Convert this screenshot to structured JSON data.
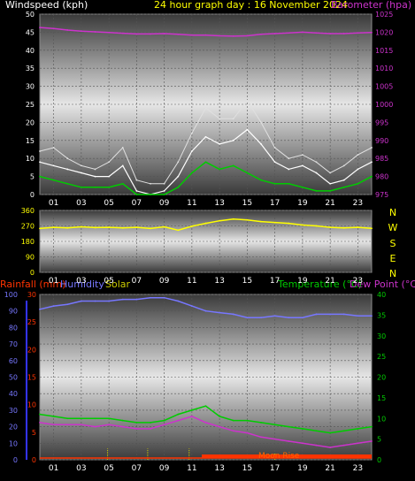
{
  "colors": {
    "windspeed": "#ffffff",
    "windgust": "#e0e0e0",
    "windavg": "#00cc00",
    "barometer": "#cc33cc",
    "direction": "#ffff00",
    "humidity": "#7777ff",
    "temperature": "#00cc00",
    "dewpoint": "#cc33cc",
    "rainfall": "#ff3300",
    "solar": "#cccc00",
    "moon": "#ff6600"
  },
  "header": {
    "windspeed_label": "Windspeed (kph)",
    "title": "24 hour graph day : 16 November 2024",
    "barometer_label": "Barometer (hpa)"
  },
  "bottom_header": {
    "rainfall_label": "Rainfall (mm)",
    "humidity_label": "Humidity",
    "solar_label": "Solar",
    "temperature_label": "Temperature (°C)",
    "dewpoint_label": "Dew Point (°C)"
  },
  "moon_label": "Moon Rise",
  "chart_data": [
    {
      "type": "line",
      "title": "24 hour graph day : 16 November 2024",
      "x_ticks": [
        "01",
        "03",
        "05",
        "07",
        "09",
        "11",
        "13",
        "15",
        "17",
        "19",
        "21",
        "23"
      ],
      "xlim": [
        0,
        24
      ],
      "ylabel_left": "Windspeed (kph)",
      "ylim_left": [
        0,
        50
      ],
      "y_ticks_left": [
        0,
        5,
        10,
        15,
        20,
        25,
        30,
        35,
        40,
        45,
        50
      ],
      "ylabel_right": "Barometer (hpa)",
      "ylim_right": [
        975,
        1025
      ],
      "y_ticks_right": [
        975,
        980,
        985,
        990,
        995,
        1000,
        1005,
        1010,
        1015,
        1020,
        1025
      ],
      "series": [
        {
          "name": "Barometer (hpa)",
          "axis": "right",
          "x": [
            0,
            1,
            2,
            3,
            4,
            5,
            6,
            7,
            8,
            9,
            10,
            11,
            12,
            13,
            14,
            15,
            16,
            17,
            18,
            19,
            20,
            21,
            22,
            23,
            24
          ],
          "values": [
            1021.3,
            1021,
            1020.6,
            1020.3,
            1020.1,
            1019.9,
            1019.7,
            1019.5,
            1019.5,
            1019.6,
            1019.4,
            1019.2,
            1019.2,
            1019,
            1018.9,
            1019,
            1019.4,
            1019.6,
            1019.8,
            1020,
            1019.8,
            1019.6,
            1019.6,
            1019.8,
            1019.9
          ]
        },
        {
          "name": "Wind gust",
          "axis": "left",
          "x": [
            0,
            1,
            2,
            3,
            4,
            5,
            6,
            7,
            8,
            9,
            10,
            11,
            12,
            13,
            14,
            15,
            16,
            17,
            18,
            19,
            20,
            21,
            22,
            23,
            24
          ],
          "values": [
            12,
            13,
            10,
            8,
            7,
            9,
            13,
            4,
            3,
            3,
            9,
            17,
            24,
            21,
            21,
            26,
            20,
            13,
            10,
            11,
            9,
            6,
            8,
            11,
            13
          ]
        },
        {
          "name": "Wind speed",
          "axis": "left",
          "x": [
            0,
            1,
            2,
            3,
            4,
            5,
            6,
            7,
            8,
            9,
            10,
            11,
            12,
            13,
            14,
            15,
            16,
            17,
            18,
            19,
            20,
            21,
            22,
            23,
            24
          ],
          "values": [
            9,
            8,
            7,
            6,
            5,
            5,
            8,
            1,
            0,
            1,
            5,
            12,
            16,
            14,
            15,
            18,
            14,
            9,
            7,
            8,
            6,
            3,
            4,
            7,
            9
          ]
        },
        {
          "name": "Wind average",
          "axis": "left",
          "x": [
            0,
            1,
            2,
            3,
            4,
            5,
            6,
            7,
            8,
            9,
            10,
            11,
            12,
            13,
            14,
            15,
            16,
            17,
            18,
            19,
            20,
            21,
            22,
            23,
            24
          ],
          "values": [
            5,
            4,
            3,
            2,
            2,
            2,
            3,
            0,
            0,
            0,
            2,
            6,
            9,
            7,
            8,
            6,
            4,
            3,
            3,
            2,
            1,
            1,
            2,
            3,
            5
          ]
        }
      ]
    },
    {
      "type": "line",
      "x_ticks": [
        "01",
        "03",
        "05",
        "07",
        "09",
        "11",
        "13",
        "15",
        "17",
        "19",
        "21",
        "23"
      ],
      "xlim": [
        0,
        24
      ],
      "ylim": [
        0,
        360
      ],
      "y_ticks": [
        0,
        90,
        180,
        270,
        360
      ],
      "y_ticks_labels": [
        "0",
        "90",
        "180",
        "270",
        "360"
      ],
      "right_labels": [
        "N",
        "W",
        "S",
        "E",
        "N"
      ],
      "series": [
        {
          "name": "Wind direction",
          "x": [
            0,
            1,
            2,
            3,
            4,
            5,
            6,
            7,
            8,
            9,
            10,
            11,
            12,
            13,
            14,
            15,
            16,
            17,
            18,
            19,
            20,
            21,
            22,
            23,
            24
          ],
          "values": [
            255,
            262,
            258,
            265,
            260,
            262,
            258,
            262,
            255,
            265,
            245,
            268,
            285,
            300,
            310,
            305,
            295,
            290,
            285,
            275,
            270,
            262,
            258,
            262,
            256
          ]
        }
      ]
    },
    {
      "type": "line",
      "x_ticks": [
        "01",
        "03",
        "05",
        "07",
        "09",
        "11",
        "13",
        "15",
        "17",
        "19",
        "21",
        "23"
      ],
      "xlim": [
        0,
        24
      ],
      "ylim_left": [
        0,
        100
      ],
      "y_ticks_left": [
        0,
        10,
        20,
        30,
        40,
        50,
        60,
        70,
        80,
        90,
        100
      ],
      "rain_ticks": [
        "0",
        "5",
        "10",
        "15",
        "20",
        "25",
        "30"
      ],
      "ylim_right": [
        0,
        40
      ],
      "y_ticks_right": [
        0,
        5,
        10,
        15,
        20,
        25,
        30,
        35,
        40
      ],
      "series": [
        {
          "name": "Humidity",
          "axis": "left",
          "x": [
            0,
            1,
            2,
            3,
            4,
            5,
            6,
            7,
            8,
            9,
            10,
            11,
            12,
            13,
            14,
            15,
            16,
            17,
            18,
            19,
            20,
            21,
            22,
            23,
            24
          ],
          "values": [
            91,
            93,
            94,
            96,
            96,
            96,
            97,
            97,
            98,
            98,
            96,
            93,
            90,
            89,
            88,
            86,
            86,
            87,
            86,
            86,
            88,
            88,
            88,
            87,
            87
          ]
        },
        {
          "name": "Temperature (°C)",
          "axis": "right",
          "x": [
            0,
            1,
            2,
            3,
            4,
            5,
            6,
            7,
            8,
            9,
            10,
            11,
            12,
            13,
            14,
            15,
            16,
            17,
            18,
            19,
            20,
            21,
            22,
            23,
            24
          ],
          "values": [
            11,
            10.5,
            10,
            10,
            10,
            10,
            9.5,
            9,
            9,
            9.5,
            11,
            12,
            13,
            10.5,
            9.5,
            9.5,
            9,
            8.5,
            8,
            7.5,
            7,
            6.5,
            7,
            7.5,
            8
          ]
        },
        {
          "name": "Dew Point (°C)",
          "axis": "right",
          "x": [
            0,
            1,
            2,
            3,
            4,
            5,
            6,
            7,
            8,
            9,
            10,
            11,
            12,
            13,
            14,
            15,
            16,
            17,
            18,
            19,
            20,
            21,
            22,
            23,
            24
          ],
          "values": [
            9,
            8.5,
            8.5,
            8.5,
            8,
            8.5,
            8,
            7.5,
            7.5,
            8.5,
            9.5,
            10.5,
            9,
            8,
            7,
            6.5,
            5.5,
            5,
            4.5,
            4,
            3.5,
            3,
            3.5,
            4,
            4.5
          ]
        },
        {
          "name": "Solar",
          "axis": "right",
          "x": [
            4.9,
            7.8,
            10.8,
            17
          ],
          "values": [
            2.7,
            2.7,
            2.7,
            1.7
          ]
        }
      ]
    }
  ]
}
